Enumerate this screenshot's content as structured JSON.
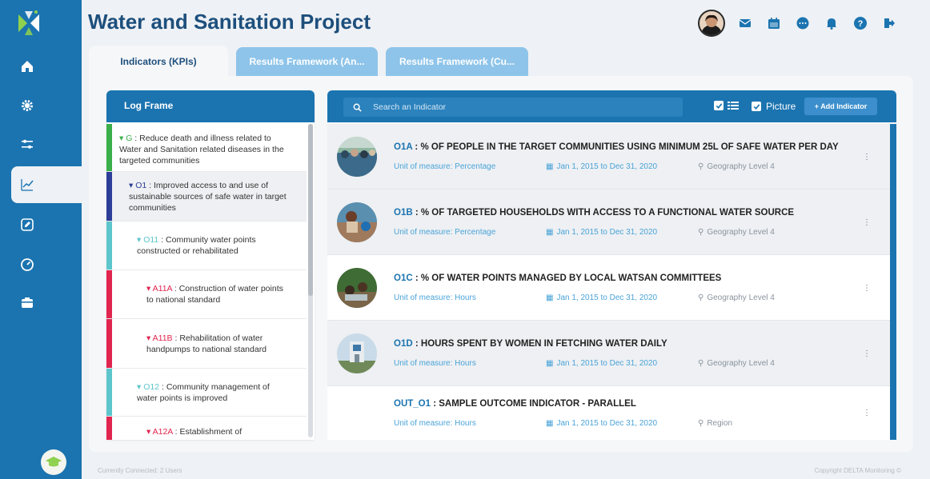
{
  "app": {
    "title": "Water and Sanitation Project"
  },
  "sidebar": {
    "items": [
      {
        "icon": "home-icon"
      },
      {
        "icon": "gear-icon"
      },
      {
        "icon": "sliders-icon"
      },
      {
        "icon": "chart-line-icon",
        "active": true
      },
      {
        "icon": "edit-icon"
      },
      {
        "icon": "gauge-icon"
      },
      {
        "icon": "card-icon"
      }
    ],
    "bottom_icon": "graduation-cap-icon"
  },
  "header": {
    "icons": [
      "avatar",
      "mail-icon",
      "calendar-icon",
      "chat-icon",
      "bell-icon",
      "help-icon",
      "logout-icon"
    ]
  },
  "tabs": [
    {
      "label": "Indicators (KPIs)",
      "active": true
    },
    {
      "label": "Results Framework (An...",
      "active": false
    },
    {
      "label": "Results Framework (Cu...",
      "active": false
    }
  ],
  "logframe": {
    "header": "Log Frame",
    "items": [
      {
        "code": "G",
        "sep": " : ",
        "text": "Reduce death and illness related to Water and Sanitation related diseases in the targeted communities",
        "color": "#3aae4a"
      },
      {
        "code": "O1",
        "sep": " : ",
        "text": "Improved access to and use of sustainable sources of safe water in target communities",
        "color": "#2c3e98"
      },
      {
        "code": "O11",
        "sep": " : ",
        "text": "Community water points constructed or rehabilitated",
        "color": "#5cc6cc"
      },
      {
        "code": "A11A",
        "sep": " : ",
        "text": "Construction of water points to national standard",
        "color": "#e0254f"
      },
      {
        "code": "A11B",
        "sep": " : ",
        "text": "Rehabilitation of water handpumps to national standard",
        "color": "#e0254f"
      },
      {
        "code": "O12",
        "sep": " : ",
        "text": "Community management of water points is improved",
        "color": "#5cc6cc"
      },
      {
        "code": "A12A",
        "sep": " : ",
        "text": "Establishment of",
        "color": "#e0254f"
      }
    ]
  },
  "search": {
    "placeholder": "Search an Indicator"
  },
  "toolbar": {
    "picture_label": "Picture",
    "add_label": "+ Add Indicator"
  },
  "indicators": [
    {
      "code": "O1A",
      "title": "% OF PEOPLE IN THE TARGET COMMUNITIES USING MINIMUM 25L OF SAFE WATER PER DAY",
      "unit": "Unit of measure: Percentage",
      "dates": "Jan 1, 2015 to Dec 31, 2020",
      "geo": "Geography Level 4"
    },
    {
      "code": "O1B",
      "title": "% OF TARGETED HOUSEHOLDS WITH ACCESS TO A FUNCTIONAL WATER SOURCE",
      "unit": "Unit of measure: Percentage",
      "dates": "Jan 1, 2015 to Dec 31, 2020",
      "geo": "Geography Level 4"
    },
    {
      "code": "O1C",
      "title": "% OF WATER POINTS MANAGED BY LOCAL WATSAN COMMITTEES",
      "unit": "Unit of measure: Hours",
      "dates": "Jan 1, 2015 to Dec 31, 2020",
      "geo": "Geography Level 4"
    },
    {
      "code": "O1D",
      "title": "HOURS SPENT BY WOMEN IN FETCHING WATER DAILY",
      "unit": "Unit of measure: Hours",
      "dates": "Jan 1, 2015 to Dec 31, 2020",
      "geo": "Geography Level 4"
    },
    {
      "code": "OUT_O1",
      "title": "SAMPLE OUTCOME INDICATOR - PARALLEL",
      "unit": "Unit of measure: Hours",
      "dates": "Jan 1, 2015 to Dec 31, 2020",
      "geo": "Region"
    }
  ],
  "footer": {
    "connected": "Currently Connected: 2 Users",
    "copyright": "Copyright DELTA Monitoring ©"
  }
}
